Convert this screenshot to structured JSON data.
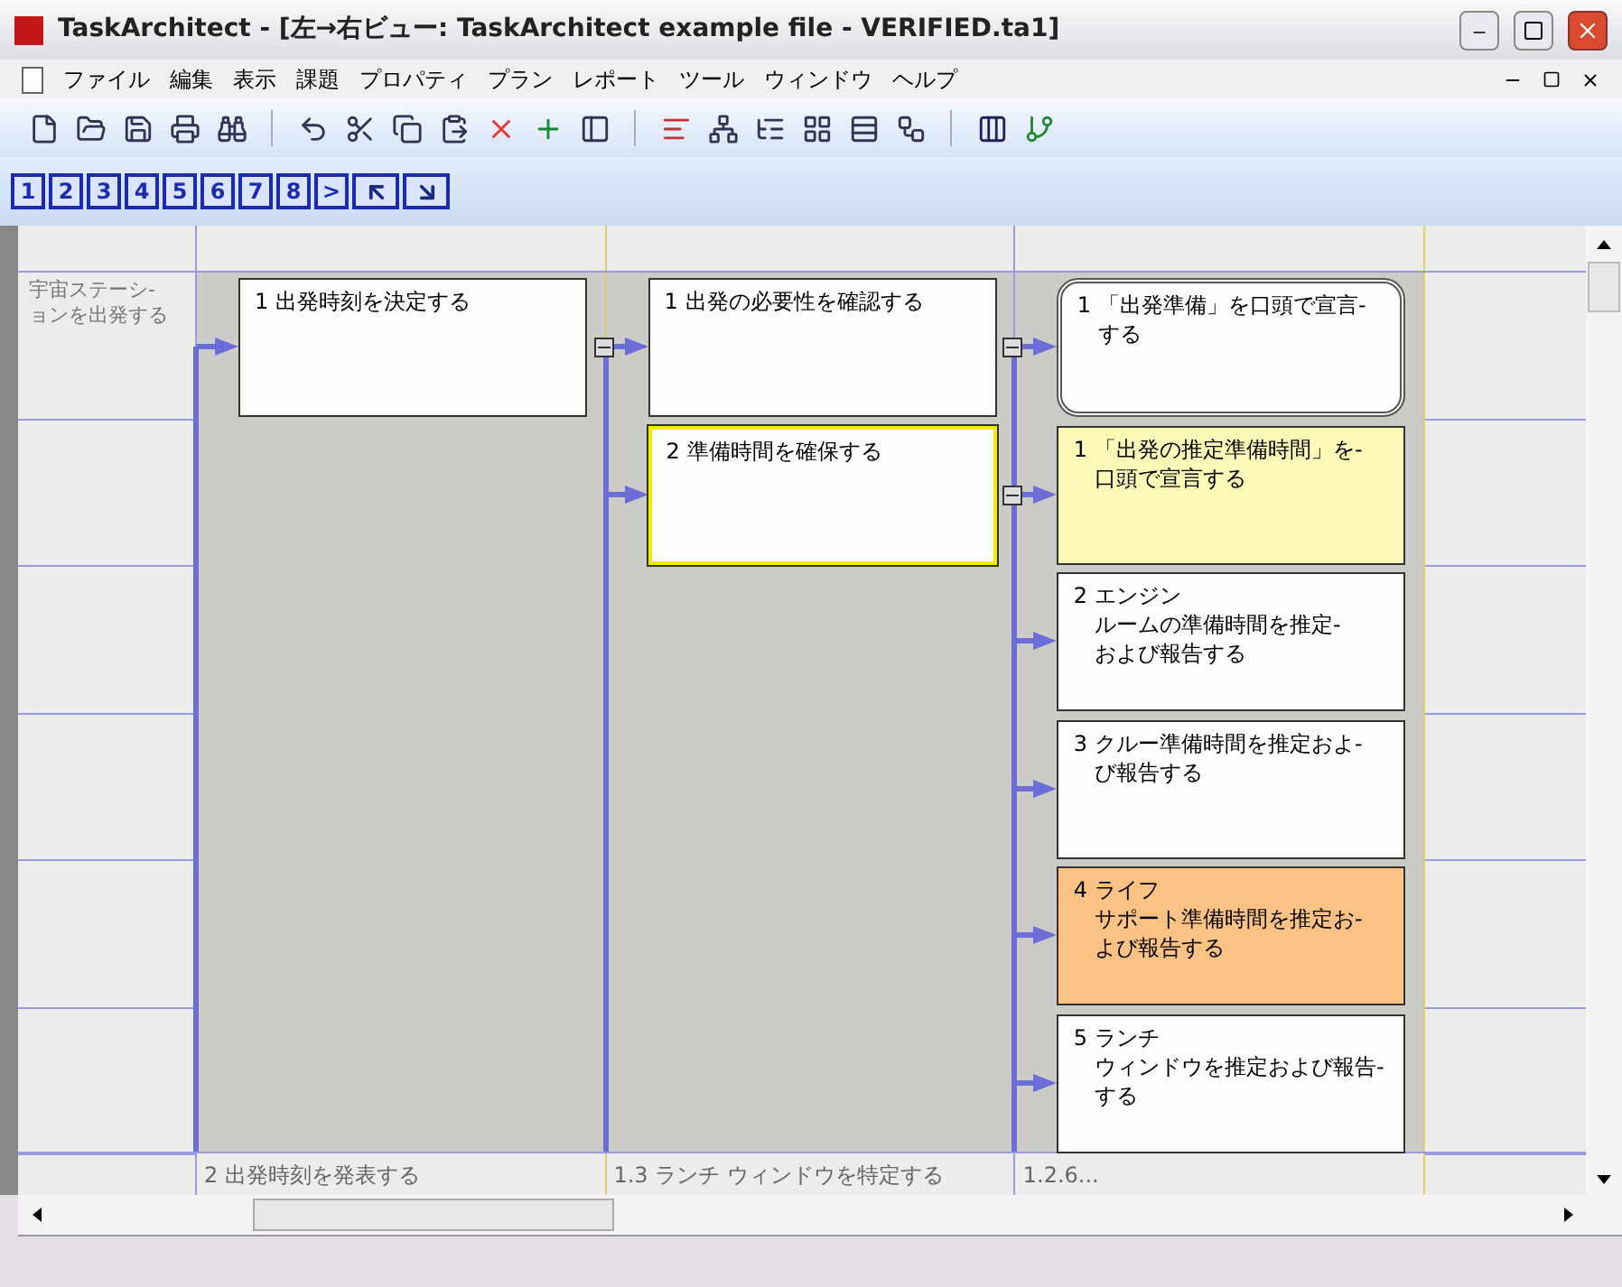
{
  "window": {
    "title": "TaskArchitect - [左→右ビュー: TaskArchitect example file - VERIFIED.ta1]"
  },
  "menu": [
    "ファイル",
    "編集",
    "表示",
    "課題",
    "プロパティ",
    "プラン",
    "レポート",
    "ツール",
    "ウィンドウ",
    "ヘルプ"
  ],
  "levels": [
    {
      "label": "1"
    },
    {
      "label": "2"
    },
    {
      "label": "3"
    },
    {
      "label": "4"
    },
    {
      "label": "5"
    },
    {
      "label": "6"
    },
    {
      "label": "7"
    },
    {
      "label": "8"
    },
    {
      "label": ">"
    }
  ],
  "diagram": {
    "root": {
      "lines": [
        "宇宙ステーシ-",
        "ョンを出発する"
      ],
      "children": [
        {
          "number": "1",
          "lines": [
            "出発時刻を決定する"
          ],
          "kind": "box",
          "selected": false,
          "color": "#fdfefc",
          "expanded": true,
          "children": [
            {
              "number": "1",
              "lines": [
                "出発の必要性を確認する"
              ],
              "kind": "box",
              "selected": false,
              "color": "#fdfefc",
              "expanded": true,
              "children": [
                {
                  "number": "1",
                  "lines": [
                    "「出発準備」を口頭で宣言-",
                    "する"
                  ],
                  "kind": "rounded",
                  "selected": false,
                  "color": "#fdfefc"
                }
              ]
            },
            {
              "number": "2",
              "lines": [
                "準備時間を確保する"
              ],
              "kind": "box",
              "selected": true,
              "color": "#fdfefc",
              "expanded": true,
              "children": [
                {
                  "number": "1",
                  "lines": [
                    "「出発の推定準備時間」を-",
                    "口頭で宣言する"
                  ],
                  "kind": "box",
                  "selected": false,
                  "color": "#fdf9b7"
                },
                {
                  "number": "2",
                  "lines": [
                    "エンジン",
                    "ルームの準備時間を推定-",
                    "および報告する"
                  ],
                  "kind": "box",
                  "selected": false,
                  "color": "#fdfefc"
                },
                {
                  "number": "3",
                  "lines": [
                    "クルー準備時間を推定およ-",
                    "び報告する"
                  ],
                  "kind": "box",
                  "selected": false,
                  "color": "#fdfefc"
                },
                {
                  "number": "4",
                  "lines": [
                    "ライフ",
                    "サポート準備時間を推定お-",
                    "よび報告する"
                  ],
                  "kind": "box",
                  "selected": false,
                  "color": "#fbc284"
                },
                {
                  "number": "5",
                  "lines": [
                    "ランチ",
                    "ウィンドウを推定および報告-",
                    "する"
                  ],
                  "kind": "box",
                  "selected": false,
                  "color": "#fdfefc"
                }
              ]
            }
          ]
        }
      ]
    },
    "footer": [
      "2 出発時刻を発表する",
      "1.3 ランチ ウィンドウを特定する",
      "1.2.6..."
    ]
  }
}
